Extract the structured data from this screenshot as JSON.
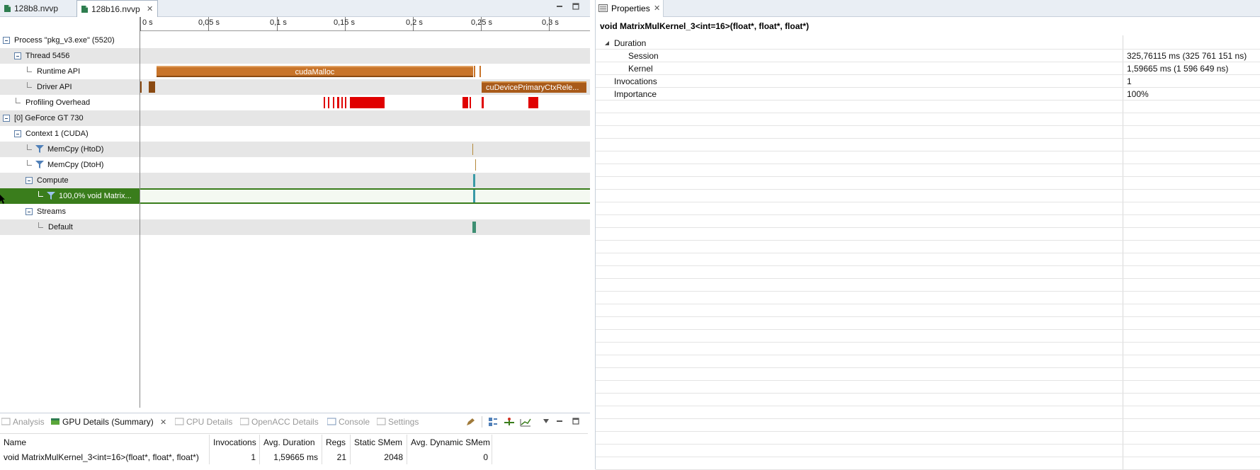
{
  "editor_tabs": [
    {
      "label": "128b8.nvvp"
    },
    {
      "label": "128b16.nvvp"
    }
  ],
  "timeline": {
    "ticks": [
      "0 s",
      "0,05 s",
      "0,1 s",
      "0,15 s",
      "0,2 s",
      "0,25 s",
      "0,3 s"
    ],
    "rows": {
      "process": "Process \"pkg_v3.exe\" (5520)",
      "thread": "Thread 5456",
      "runtime_api": "Runtime API",
      "driver_api": "Driver API",
      "profiling_overhead": "Profiling Overhead",
      "device": "[0] GeForce GT 730",
      "context": "Context 1 (CUDA)",
      "memcpy_htod": "MemCpy (HtoD)",
      "memcpy_dtoh": "MemCpy (DtoH)",
      "compute": "Compute",
      "kernel_row": "100,0% void Matrix...",
      "streams": "Streams",
      "default_stream": "Default"
    },
    "bars": {
      "runtime_label": "cudaMalloc",
      "driver_label": "cuDevicePrimaryCtxRele..."
    }
  },
  "bottom_tabs": [
    {
      "label": "Analysis"
    },
    {
      "label": "GPU Details (Summary)"
    },
    {
      "label": "CPU Details"
    },
    {
      "label": "OpenACC Details"
    },
    {
      "label": "Console"
    },
    {
      "label": "Settings"
    }
  ],
  "gpu_table": {
    "headers": [
      "Name",
      "Invocations",
      "Avg. Duration",
      "Regs",
      "Static SMem",
      "Avg. Dynamic SMem"
    ],
    "rows": [
      [
        "void MatrixMulKernel_3<int=16>(float*, float*, float*)",
        "1",
        "1,59665 ms",
        "21",
        "2048",
        "0"
      ]
    ]
  },
  "properties": {
    "tab_label": "Properties",
    "title": "void MatrixMulKernel_3<int=16>(float*, float*, float*)",
    "items": [
      {
        "name": "Duration",
        "value": ""
      },
      {
        "name": "Session",
        "value": "325,76115 ms (325 761 151 ns)"
      },
      {
        "name": "Kernel",
        "value": "1,59665 ms (1 596 649 ns)"
      },
      {
        "name": "Invocations",
        "value": "1"
      },
      {
        "name": "Importance",
        "value": "100%"
      }
    ]
  },
  "colors": {
    "selection_green": "#3a7d1c",
    "api_orange": "#c8742a",
    "overhead_red": "#e00000",
    "kernel_teal": "#3a9aa6"
  }
}
